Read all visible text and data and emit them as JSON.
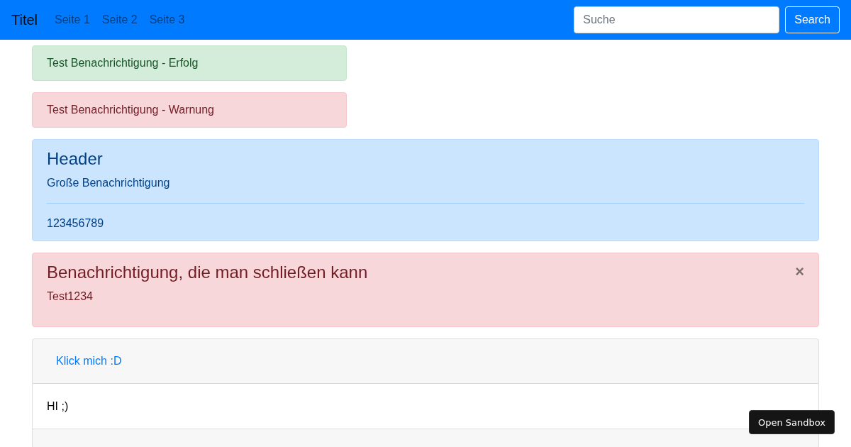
{
  "navbar": {
    "brand": "Titel",
    "links": [
      "Seite 1",
      "Seite 2",
      "Seite 3"
    ],
    "search": {
      "placeholder": "Suche",
      "button": "Search"
    }
  },
  "alerts": [
    {
      "kind": "success",
      "text": "Test Benachrichtigung - Erfolg"
    },
    {
      "kind": "danger",
      "text": "Test Benachrichtigung - Warnung"
    }
  ],
  "info_alert": {
    "kind": "info",
    "heading": "Header",
    "text": "Große Benachrichtigung",
    "footer": "123456789"
  },
  "dismissible_alert": {
    "kind": "danger",
    "heading": "Benachrichtigung, die man schließen kann",
    "text": "Test1234",
    "close": "×"
  },
  "accordion": [
    {
      "title": "Klick mich :D",
      "expanded": true,
      "body": "HI ;)"
    },
    {
      "expanded": false
    }
  ],
  "sandbox_button": "Open Sandbox"
}
